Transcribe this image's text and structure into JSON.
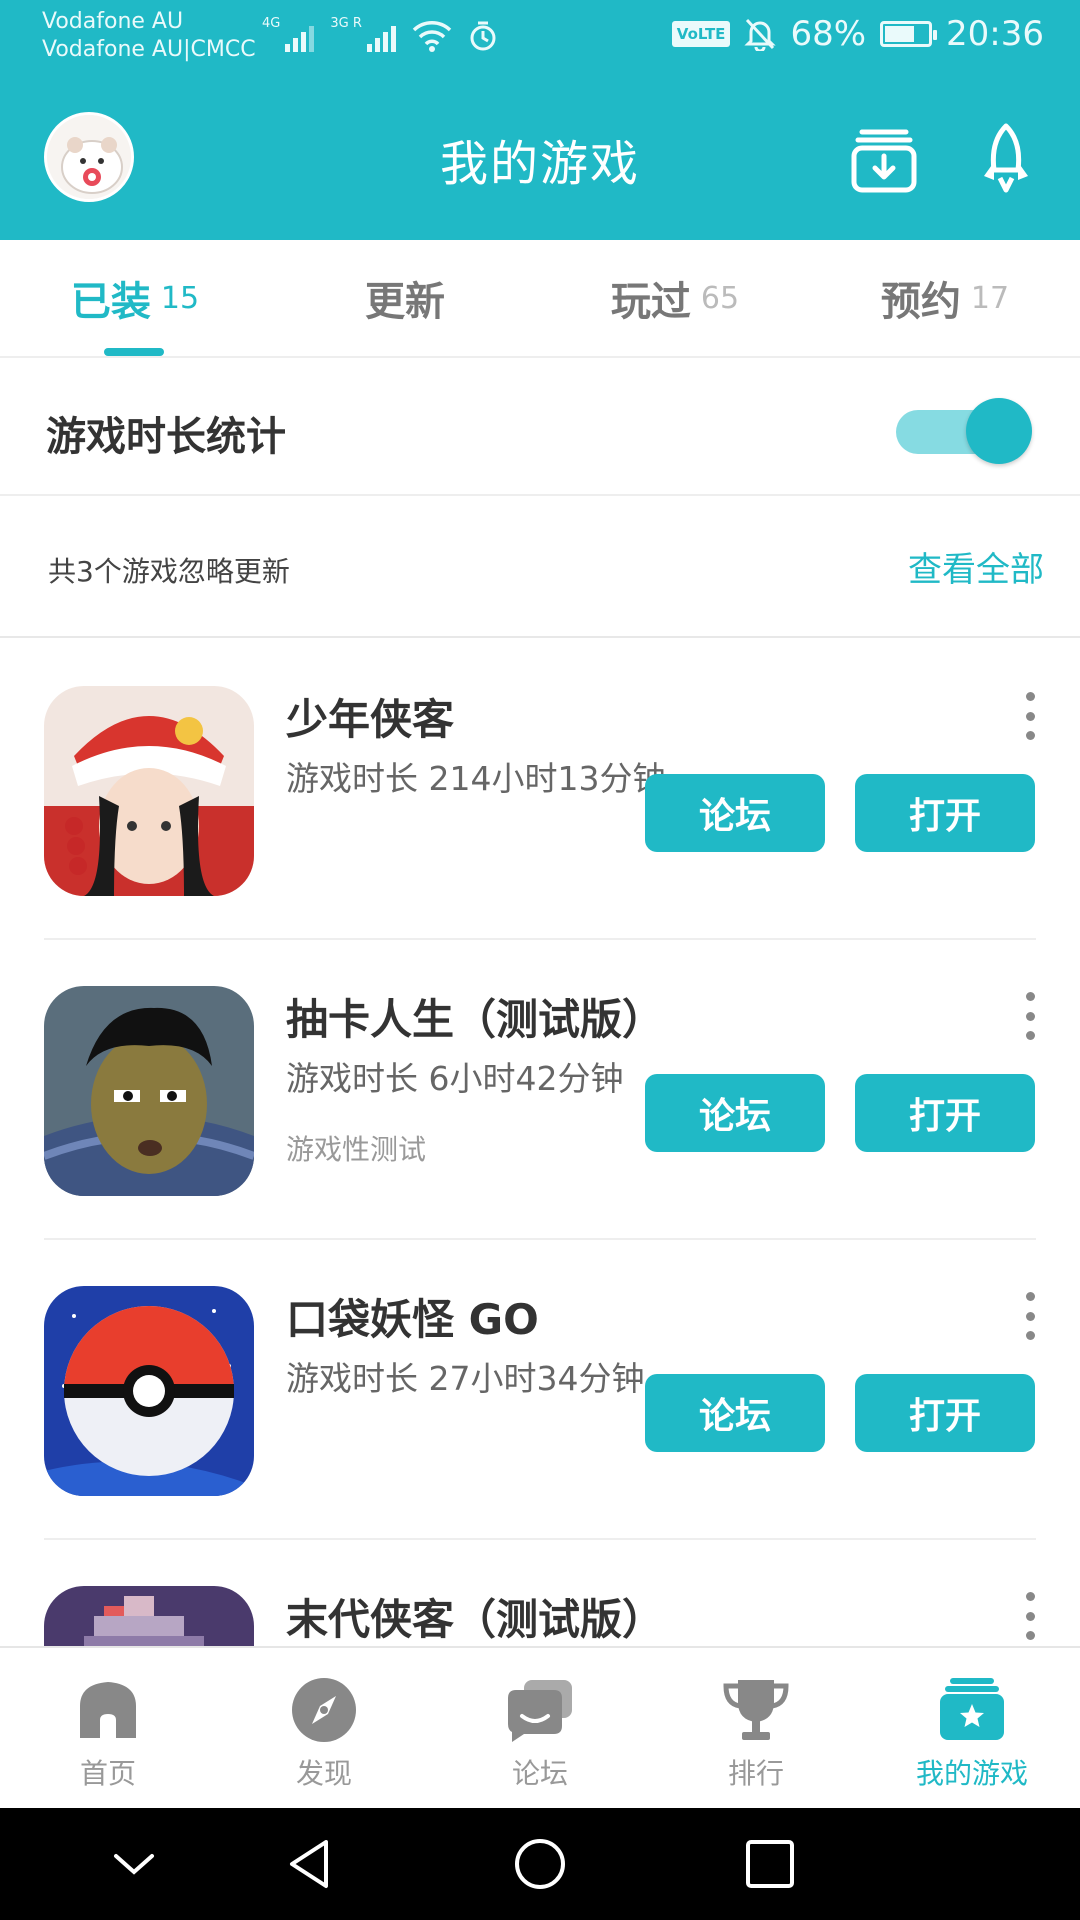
{
  "status_bar": {
    "carrier_1": "Vodafone AU",
    "carrier_2": "Vodafone AU|CMCC",
    "net_1": "4G",
    "net_2": "3G R",
    "volte": "VoLTE",
    "battery": "68%",
    "battery_level": 0.68,
    "time": "20:36"
  },
  "header": {
    "title": "我的游戏"
  },
  "tabs": [
    {
      "label": "已装",
      "count": "15",
      "active": true
    },
    {
      "label": "更新",
      "count": "",
      "active": false
    },
    {
      "label": "玩过",
      "count": "65",
      "active": false
    },
    {
      "label": "预约",
      "count": "17",
      "active": false
    }
  ],
  "stat": {
    "label": "游戏时长统计",
    "enabled": true
  },
  "ignore": {
    "text": "共3个游戏忽略更新",
    "view_all": "查看全部"
  },
  "games": [
    {
      "name": "少年侠客",
      "time": "游戏时长 214小时13分钟",
      "sub": "",
      "forum": "论坛",
      "open": "打开"
    },
    {
      "name": "抽卡人生（测试版）",
      "time": "游戏时长 6小时42分钟",
      "sub": "游戏性测试",
      "forum": "论坛",
      "open": "打开"
    },
    {
      "name": "口袋妖怪 GO",
      "time": "游戏时长 27小时34分钟",
      "sub": "",
      "forum": "论坛",
      "open": "打开"
    },
    {
      "name": "末代侠客（测试版）",
      "time": "",
      "sub": "",
      "forum": "",
      "open": ""
    }
  ],
  "bottom_nav": [
    {
      "label": "首页",
      "icon": "home-icon"
    },
    {
      "label": "发现",
      "icon": "compass-icon"
    },
    {
      "label": "论坛",
      "icon": "chat-icon"
    },
    {
      "label": "排行",
      "icon": "trophy-icon"
    },
    {
      "label": "我的游戏",
      "icon": "games-star-icon",
      "active": true
    }
  ],
  "colors": {
    "accent": "#20b9c6",
    "toggle_track": "#86dbe2"
  }
}
